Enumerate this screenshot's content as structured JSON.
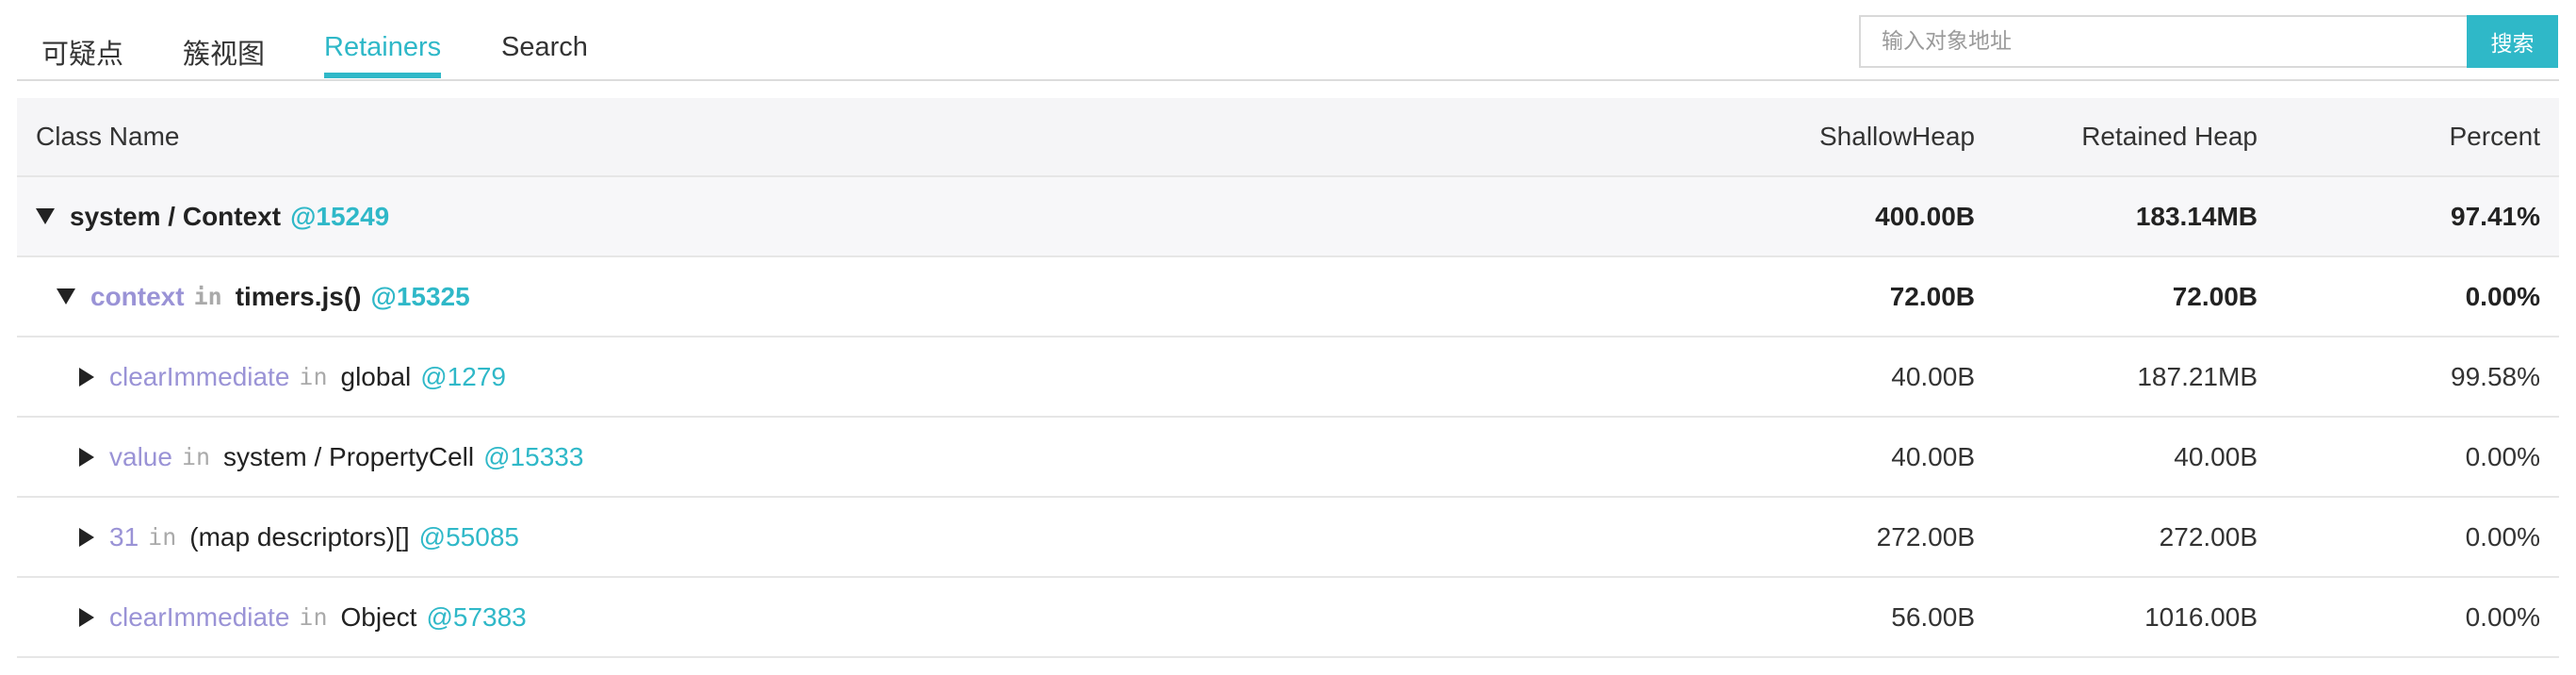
{
  "tabs": [
    {
      "label": "可疑点",
      "active": false
    },
    {
      "label": "簇视图",
      "active": false
    },
    {
      "label": "Retainers",
      "active": true
    },
    {
      "label": "Search",
      "active": false
    }
  ],
  "search": {
    "placeholder": "输入对象地址",
    "value": "",
    "button_label": "搜索"
  },
  "table": {
    "headers": {
      "class_name": "Class Name",
      "shallow_heap": "ShallowHeap",
      "retained_heap": "Retained Heap",
      "percent": "Percent"
    },
    "rows": [
      {
        "level": 0,
        "expanded": true,
        "edge": "",
        "in": "",
        "name": "system / Context",
        "id": "@15249",
        "shallow": "400.00B",
        "retained": "183.14MB",
        "percent": "97.41%"
      },
      {
        "level": 1,
        "expanded": true,
        "edge": "context",
        "in": "in",
        "name": "timers.js()",
        "id": "@15325",
        "shallow": "72.00B",
        "retained": "72.00B",
        "percent": "0.00%"
      },
      {
        "level": 2,
        "expanded": false,
        "edge": "clearImmediate",
        "in": "in",
        "name": "global",
        "id": "@1279",
        "shallow": "40.00B",
        "retained": "187.21MB",
        "percent": "99.58%"
      },
      {
        "level": 2,
        "expanded": false,
        "edge": "value",
        "in": "in",
        "name": "system / PropertyCell",
        "id": "@15333",
        "shallow": "40.00B",
        "retained": "40.00B",
        "percent": "0.00%"
      },
      {
        "level": 2,
        "expanded": false,
        "edge": "31",
        "in": "in",
        "name": "(map descriptors)[]",
        "id": "@55085",
        "shallow": "272.00B",
        "retained": "272.00B",
        "percent": "0.00%"
      },
      {
        "level": 2,
        "expanded": false,
        "edge": "clearImmediate",
        "in": "in",
        "name": "Object",
        "id": "@57383",
        "shallow": "56.00B",
        "retained": "1016.00B",
        "percent": "0.00%"
      }
    ]
  },
  "icons": {
    "expanded": "triangle-down-icon",
    "collapsed": "triangle-right-icon"
  },
  "colors": {
    "accent": "#2fb8c8",
    "edge_label": "#9a93d6",
    "in_keyword": "#aaaaaa"
  }
}
